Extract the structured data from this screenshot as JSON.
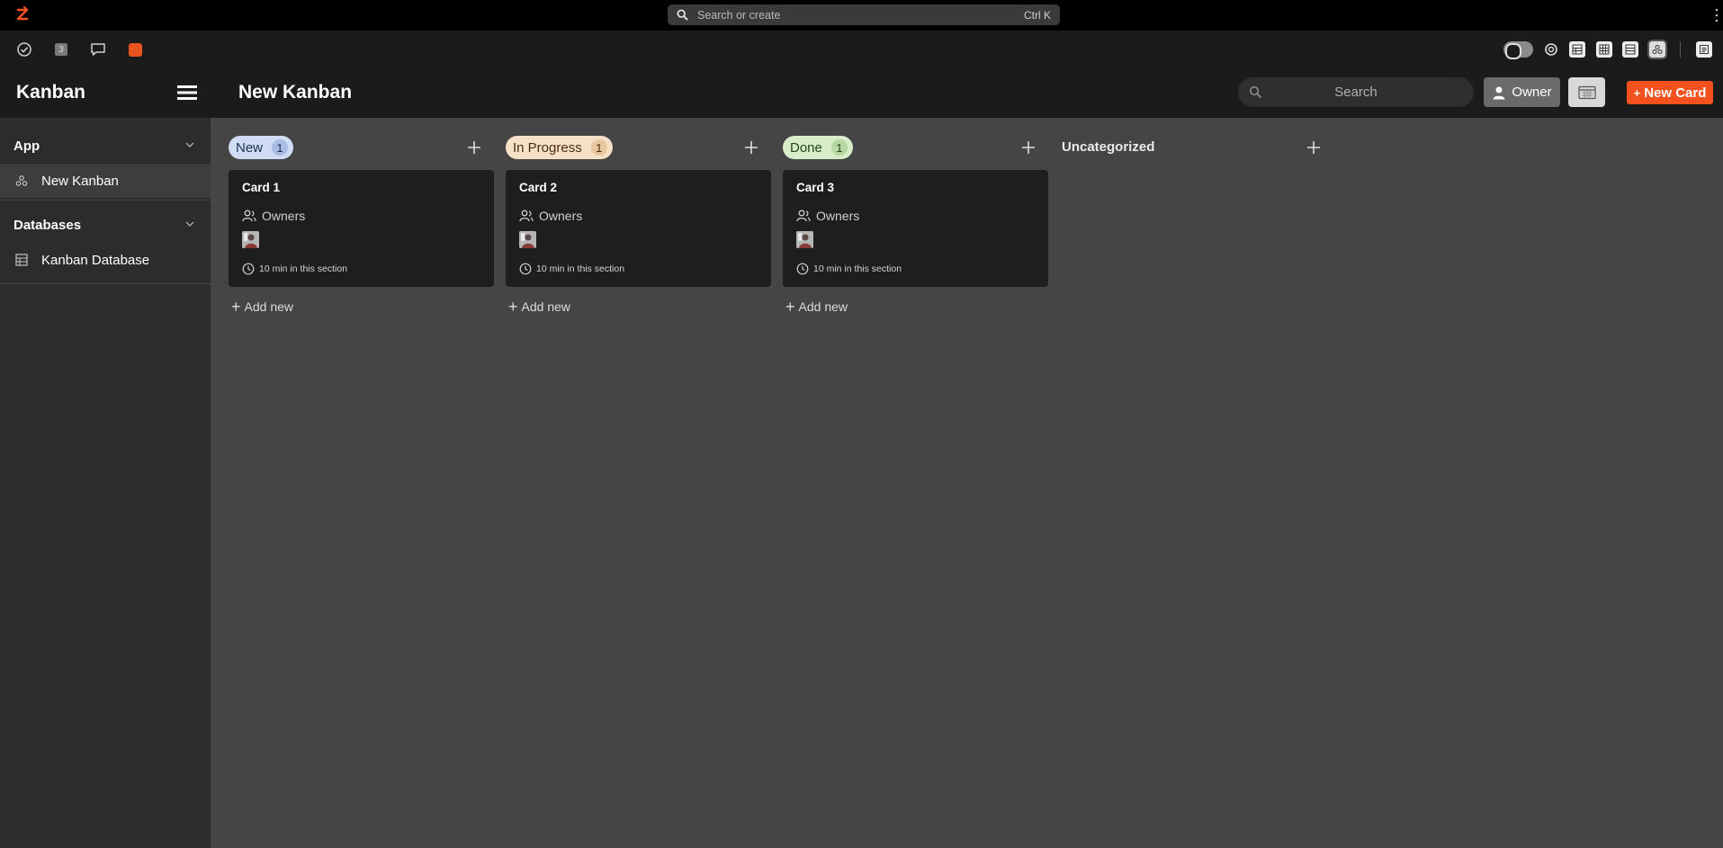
{
  "global_search": {
    "placeholder": "Search or create",
    "shortcut": "Ctrl K"
  },
  "toolbar": {
    "inbox_count": "3"
  },
  "header": {
    "app_title": "Kanban",
    "page_title": "New Kanban",
    "search_placeholder": "Search",
    "owner_label": "Owner",
    "new_card_label": "New Card"
  },
  "sidebar": {
    "sections": [
      {
        "label": "App",
        "items": [
          {
            "label": "New Kanban",
            "icon": "kanban-icon",
            "active": true
          }
        ]
      },
      {
        "label": "Databases",
        "items": [
          {
            "label": "Kanban Database",
            "icon": "table-icon",
            "active": false
          }
        ]
      }
    ]
  },
  "board": {
    "columns": [
      {
        "label": "New",
        "count": "1",
        "color": "#cfdcf3",
        "cards": [
          {
            "title": "Card 1",
            "owners_label": "Owners",
            "time": "10 min in this section"
          }
        ],
        "add_new": "Add new"
      },
      {
        "label": "In Progress",
        "count": "1",
        "color": "#f6e1c7",
        "cards": [
          {
            "title": "Card 2",
            "owners_label": "Owners",
            "time": "10 min in this section"
          }
        ],
        "add_new": "Add new"
      },
      {
        "label": "Done",
        "count": "1",
        "color": "#d7eec8",
        "cards": [
          {
            "title": "Card 3",
            "owners_label": "Owners",
            "time": "10 min in this section"
          }
        ],
        "add_new": "Add new"
      },
      {
        "label": "Uncategorized",
        "cards": []
      }
    ]
  },
  "colors": {
    "accent": "#f4511e",
    "topbar": "#000000",
    "panel": "#1b1b1b",
    "board": "#454545"
  }
}
